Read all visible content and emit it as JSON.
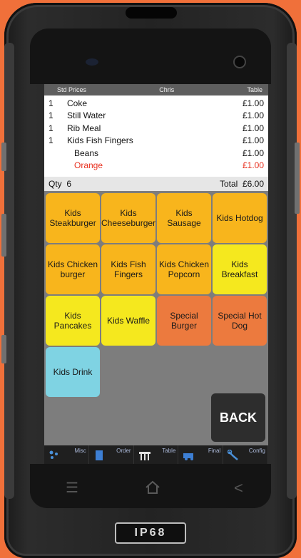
{
  "colors": {
    "background": "#f0703a",
    "kids_tile": "#f8b51c",
    "yellow_tile": "#f5e81e",
    "special_tile": "#ec7a3e",
    "drink_tile": "#7fd3e3"
  },
  "order": {
    "header": {
      "price_mode": "Std Prices",
      "user": "Chris",
      "table_label": "Table"
    },
    "items": [
      {
        "qty": "1",
        "name": "Coke",
        "price": "£1.00"
      },
      {
        "qty": "1",
        "name": "Still Water",
        "price": "£1.00"
      },
      {
        "qty": "1",
        "name": "Rib Meal",
        "price": "£1.00"
      },
      {
        "qty": "1",
        "name": "Kids Fish Fingers",
        "price": "£1.00"
      },
      {
        "qty": "",
        "name": "Beans",
        "price": "£1.00"
      },
      {
        "qty": "",
        "name": "Orange",
        "price": "£1.00"
      }
    ],
    "qty_label": "Qty",
    "qty_value": "6",
    "total_label": "Total",
    "total_value": "£6.00"
  },
  "menu": {
    "tiles": [
      "Kids Steakburger",
      "Kids Cheeseburger",
      "Kids Sausage",
      "Kids Hotdog",
      "Kids Chicken burger",
      "Kids Fish Fingers",
      "Kids Chicken Popcorn",
      "Kids Breakfast",
      "Kids Pancakes",
      "Kids Waffle",
      "Special Burger",
      "Special Hot Dog",
      "Kids Drink"
    ],
    "back_label": "BACK"
  },
  "toolbar": {
    "items": [
      {
        "label": "Misc",
        "icon": "misc-icon"
      },
      {
        "label": "Order",
        "icon": "order-icon"
      },
      {
        "label": "Table",
        "icon": "table-icon"
      },
      {
        "label": "Final",
        "icon": "final-icon"
      },
      {
        "label": "Config",
        "icon": "config-icon"
      }
    ]
  },
  "device": {
    "brand": "IP68"
  }
}
